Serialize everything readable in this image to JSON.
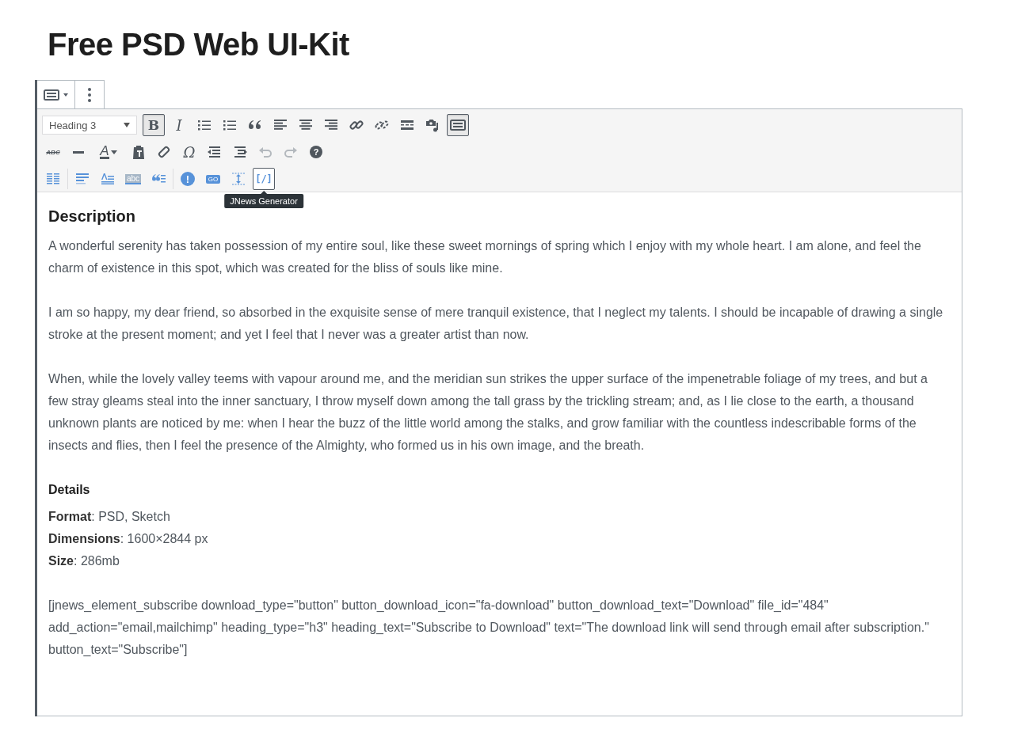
{
  "page_title": "Free PSD Web UI-Kit",
  "block_toolbar": [
    {
      "kind": "keyboard"
    },
    {
      "kind": "more"
    }
  ],
  "format_select": {
    "value": "Heading 3"
  },
  "toolbar_rows": [
    [
      {
        "kind": "bold",
        "label": "B",
        "pressed": true
      },
      {
        "kind": "italic",
        "label": "I",
        "pressed": false
      },
      {
        "kind": "bullet-list",
        "pressed": false
      },
      {
        "kind": "numbered-list",
        "pressed": false
      },
      {
        "kind": "quote",
        "pressed": false
      },
      {
        "kind": "align-left",
        "pressed": false
      },
      {
        "kind": "align-center",
        "pressed": false
      },
      {
        "kind": "align-right",
        "pressed": false
      },
      {
        "kind": "link",
        "pressed": false
      },
      {
        "kind": "unlink",
        "pressed": false
      },
      {
        "kind": "read-more",
        "pressed": false
      },
      {
        "kind": "media",
        "pressed": false
      },
      {
        "kind": "keyboard",
        "pressed": true
      }
    ],
    [
      {
        "kind": "strike",
        "label": "ABC",
        "disabled": false
      },
      {
        "kind": "hr",
        "disabled": false
      },
      {
        "kind": "text-color",
        "label": "A",
        "disabled": false
      },
      {
        "kind": "paste",
        "disabled": false
      },
      {
        "kind": "eraser",
        "disabled": false
      },
      {
        "kind": "omega",
        "label": "Ω",
        "disabled": false
      },
      {
        "kind": "outdent",
        "disabled": false
      },
      {
        "kind": "indent",
        "disabled": false
      },
      {
        "kind": "undo",
        "disabled": true
      },
      {
        "kind": "redo",
        "disabled": true
      },
      {
        "kind": "help",
        "label": "?",
        "disabled": false
      }
    ],
    [
      {
        "kind": "columns",
        "hovered": false
      },
      {
        "kind": "separator"
      },
      {
        "kind": "lines",
        "hovered": false
      },
      {
        "kind": "text-lines",
        "hovered": false
      },
      {
        "kind": "highlight",
        "label": "abc",
        "hovered": false
      },
      {
        "kind": "quote-lines",
        "hovered": false
      },
      {
        "kind": "separator"
      },
      {
        "kind": "alert",
        "label": "!",
        "hovered": false
      },
      {
        "kind": "go",
        "label": "GO",
        "hovered": false
      },
      {
        "kind": "spacing",
        "hovered": false
      },
      {
        "kind": "shortcode",
        "label": "[/]",
        "hovered": true
      }
    ]
  ],
  "tooltip": "JNews Generator",
  "content": [
    {
      "kind": "heading",
      "text": "Description"
    },
    {
      "kind": "paragraph",
      "text": "A wonderful serenity has taken possession of my entire soul, like these sweet mornings of spring which I enjoy with my whole heart. I am alone, and feel the charm of existence in this spot, which was created for the bliss of souls like mine."
    },
    {
      "kind": "paragraph",
      "text": "I am so happy, my dear friend, so absorbed in the exquisite sense of mere tranquil existence, that I neglect my talents. I should be incapable of drawing a single stroke at the present moment; and yet I feel that I never was a greater artist than now."
    },
    {
      "kind": "paragraph",
      "text": "When, while the lovely valley teems with vapour around me, and the meridian sun strikes the upper surface of the impenetrable foliage of my trees, and but a few stray gleams steal into the inner sanctuary, I throw myself down among the tall grass by the trickling stream; and, as I lie close to the earth, a thousand unknown plants are noticed by me: when I hear the buzz of the little world among the stalks, and grow familiar with the countless indescribable forms of the insects and flies, then I feel the presence of the Almighty, who formed us in his own image, and the breath."
    },
    {
      "kind": "subheading",
      "text": "Details"
    },
    {
      "kind": "lines",
      "items": [
        "**Format**: PSD, Sketch",
        "**Dimensions**: 1600×2844 px",
        "**Size**: 286mb"
      ]
    },
    {
      "kind": "paragraph",
      "text": "[jnews_element_subscribe download_type=\"button\" button_download_icon=\"fa-download\" button_download_text=\"Download\" file_id=\"484\" add_action=\"email,mailchimp\" heading_type=\"h3\" heading_text=\"Subscribe to Download\" text=\"The download link will send through email after subscription.\" button_text=\"Subscribe\"]"
    }
  ]
}
